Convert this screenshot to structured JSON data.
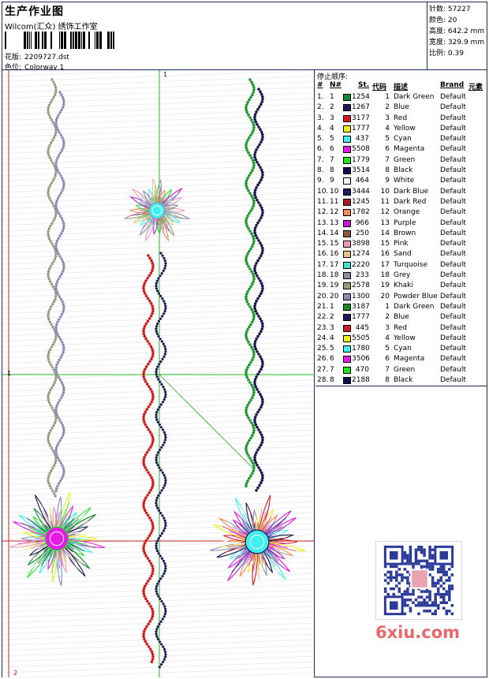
{
  "header": {
    "title": "生产作业图",
    "company": "Wilcom(汇众) 绣饰工作室",
    "design_label": "花版:",
    "design_value": "2209727.dst",
    "colorway_label": "色位:",
    "colorway_value": "Colorway 1"
  },
  "stats": [
    {
      "label": "针数:",
      "value": "57227"
    },
    {
      "label": "颜色:",
      "value": "20"
    },
    {
      "label": "高度:",
      "value": "642.2 mm"
    },
    {
      "label": "宽度:",
      "value": "329.9 mm"
    },
    {
      "label": "比例:",
      "value": "0.39"
    }
  ],
  "canvas": {
    "marker_top": "1",
    "marker_left": "1",
    "marker_bottom": "2"
  },
  "stops": {
    "title": "停止顺序:",
    "headers": {
      "idx": "#",
      "n": "N#",
      "st": "St.",
      "code": "代码",
      "desc": "描述",
      "brand": "Brand",
      "element": "元素"
    },
    "rows": [
      {
        "idx": "1.",
        "n": "1",
        "color": "#118a2e",
        "st": "1254",
        "code": "1",
        "desc": "Dark Green",
        "brand": "Default"
      },
      {
        "idx": "2.",
        "n": "2",
        "color": "#1a1a5e",
        "st": "1267",
        "code": "2",
        "desc": "Blue",
        "brand": "Default"
      },
      {
        "idx": "3.",
        "n": "3",
        "color": "#d41b1b",
        "st": "3177",
        "code": "3",
        "desc": "Red",
        "brand": "Default"
      },
      {
        "idx": "4.",
        "n": "4",
        "color": "#f0f01a",
        "st": "1777",
        "code": "4",
        "desc": "Yellow",
        "brand": "Default"
      },
      {
        "idx": "5.",
        "n": "5",
        "color": "#3ff0ef",
        "st": "437",
        "code": "5",
        "desc": "Cyan",
        "brand": "Default"
      },
      {
        "idx": "6.",
        "n": "6",
        "color": "#e51ce5",
        "st": "5508",
        "code": "6",
        "desc": "Magenta",
        "brand": "Default"
      },
      {
        "idx": "7.",
        "n": "7",
        "color": "#26e326",
        "st": "1779",
        "code": "7",
        "desc": "Green",
        "brand": "Default"
      },
      {
        "idx": "8.",
        "n": "8",
        "color": "#101050",
        "st": "3514",
        "code": "8",
        "desc": "Black",
        "brand": "Default"
      },
      {
        "idx": "9.",
        "n": "9",
        "color": "#f7f7f7",
        "st": "464",
        "code": "9",
        "desc": "White",
        "brand": "Default"
      },
      {
        "idx": "10.",
        "n": "10",
        "color": "#1b1b6a",
        "st": "3444",
        "code": "10",
        "desc": "Dark Blue",
        "brand": "Default"
      },
      {
        "idx": "11.",
        "n": "11",
        "color": "#a81e1e",
        "st": "1245",
        "code": "11",
        "desc": "Dark Red",
        "brand": "Default"
      },
      {
        "idx": "12.",
        "n": "12",
        "color": "#f08a5a",
        "st": "1782",
        "code": "12",
        "desc": "Orange",
        "brand": "Default"
      },
      {
        "idx": "13.",
        "n": "13",
        "color": "#c41ccf",
        "st": "966",
        "code": "13",
        "desc": "Purple",
        "brand": "Default"
      },
      {
        "idx": "14.",
        "n": "14",
        "color": "#8c5a3a",
        "st": "250",
        "code": "14",
        "desc": "Brown",
        "brand": "Default"
      },
      {
        "idx": "15.",
        "n": "15",
        "color": "#f09ab6",
        "st": "3898",
        "code": "15",
        "desc": "Pink",
        "brand": "Default"
      },
      {
        "idx": "16.",
        "n": "16",
        "color": "#e8c28e",
        "st": "1274",
        "code": "16",
        "desc": "Sand",
        "brand": "Default"
      },
      {
        "idx": "17.",
        "n": "17",
        "color": "#45e0d3",
        "st": "2220",
        "code": "17",
        "desc": "Turquoise",
        "brand": "Default"
      },
      {
        "idx": "18.",
        "n": "18",
        "color": "#8a8aa6",
        "st": "233",
        "code": "18",
        "desc": "Grey",
        "brand": "Default"
      },
      {
        "idx": "19.",
        "n": "19",
        "color": "#9a9a78",
        "st": "2578",
        "code": "19",
        "desc": "Khaki",
        "brand": "Default"
      },
      {
        "idx": "20.",
        "n": "20",
        "color": "#8a8ab8",
        "st": "1300",
        "code": "20",
        "desc": "Powder Blue",
        "brand": "Default"
      },
      {
        "idx": "21.",
        "n": "1",
        "color": "#118a2e",
        "st": "3187",
        "code": "1",
        "desc": "Dark Green",
        "brand": "Default"
      },
      {
        "idx": "22.",
        "n": "2",
        "color": "#1a1a5e",
        "st": "1777",
        "code": "2",
        "desc": "Blue",
        "brand": "Default"
      },
      {
        "idx": "23.",
        "n": "3",
        "color": "#d41b1b",
        "st": "445",
        "code": "3",
        "desc": "Red",
        "brand": "Default"
      },
      {
        "idx": "24.",
        "n": "4",
        "color": "#f0f01a",
        "st": "5505",
        "code": "4",
        "desc": "Yellow",
        "brand": "Default"
      },
      {
        "idx": "25.",
        "n": "5",
        "color": "#3ff0ef",
        "st": "1780",
        "code": "5",
        "desc": "Cyan",
        "brand": "Default"
      },
      {
        "idx": "26.",
        "n": "6",
        "color": "#e51ce5",
        "st": "3506",
        "code": "6",
        "desc": "Magenta",
        "brand": "Default"
      },
      {
        "idx": "27.",
        "n": "7",
        "color": "#26e326",
        "st": "470",
        "code": "7",
        "desc": "Green",
        "brand": "Default"
      },
      {
        "idx": "28.",
        "n": "8",
        "color": "#101050",
        "st": "2188",
        "code": "8",
        "desc": "Black",
        "brand": "Default"
      }
    ]
  },
  "watermark": "6xiu.com"
}
